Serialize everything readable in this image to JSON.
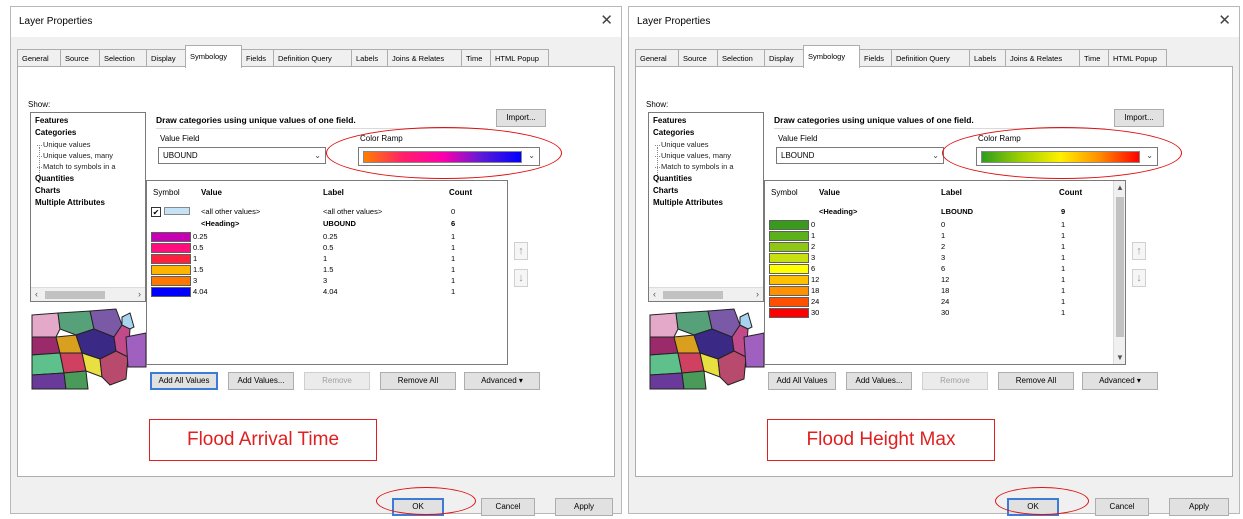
{
  "left": {
    "window_title": "Layer Properties",
    "close_symbol": "✕",
    "tabs": [
      {
        "label": "General"
      },
      {
        "label": "Source"
      },
      {
        "label": "Selection"
      },
      {
        "label": "Display"
      },
      {
        "label": "Symbology"
      },
      {
        "label": "Fields"
      },
      {
        "label": "Definition Query"
      },
      {
        "label": "Labels"
      },
      {
        "label": "Joins & Relates"
      },
      {
        "label": "Time"
      },
      {
        "label": "HTML Popup"
      }
    ],
    "active_tab": "Symbology",
    "show_label": "Show:",
    "show_items": [
      {
        "label": "Features"
      },
      {
        "label": "Categories"
      },
      {
        "label": "Unique values"
      },
      {
        "label": "Unique values, many"
      },
      {
        "label": "Match to symbols in a"
      },
      {
        "label": "Quantities"
      },
      {
        "label": "Charts"
      },
      {
        "label": "Multiple Attributes"
      }
    ],
    "description": "Draw categories using unique values of one field.",
    "import_label": "Import...",
    "value_field_label": "Value Field",
    "value_field_value": "UBOUND",
    "color_ramp_label": "Color Ramp",
    "color_ramp_colors": [
      "#ff7f00",
      "#ff1f6a",
      "#ff00aa",
      "#5d1bd6",
      "#0000ff"
    ],
    "table_headers": {
      "symbol": "Symbol",
      "value": "Value",
      "label": "Label",
      "count": "Count"
    },
    "other_values": {
      "check": "✔",
      "value": "<all other values>",
      "label": "<all other values>",
      "count": "0"
    },
    "heading": {
      "value": "<Heading>",
      "label": "UBOUND",
      "count": "6"
    },
    "rows": [
      {
        "value": "0.25",
        "label": "0.25",
        "count": "1",
        "color": "#c800b4"
      },
      {
        "value": "0.5",
        "label": "0.5",
        "count": "1",
        "color": "#ff0f7d"
      },
      {
        "value": "1",
        "label": "1",
        "count": "1",
        "color": "#ff2040"
      },
      {
        "value": "1.5",
        "label": "1.5",
        "count": "1",
        "color": "#ffb400"
      },
      {
        "value": "3",
        "label": "3",
        "count": "1",
        "color": "#ff7800"
      },
      {
        "value": "4.04",
        "label": "4.04",
        "count": "1",
        "color": "#0000ff"
      }
    ],
    "buttons": {
      "add_all": "Add All Values",
      "add_values": "Add Values...",
      "remove": "Remove",
      "remove_all": "Remove All",
      "advanced": "Advanced"
    },
    "callout": "Flood Arrival Time",
    "ok": "OK",
    "cancel": "Cancel",
    "apply": "Apply"
  },
  "right": {
    "window_title": "Layer Properties",
    "close_symbol": "✕",
    "tabs": [
      {
        "label": "General"
      },
      {
        "label": "Source"
      },
      {
        "label": "Selection"
      },
      {
        "label": "Display"
      },
      {
        "label": "Symbology"
      },
      {
        "label": "Fields"
      },
      {
        "label": "Definition Query"
      },
      {
        "label": "Labels"
      },
      {
        "label": "Joins & Relates"
      },
      {
        "label": "Time"
      },
      {
        "label": "HTML Popup"
      }
    ],
    "active_tab": "Symbology",
    "show_label": "Show:",
    "show_items": [
      {
        "label": "Features"
      },
      {
        "label": "Categories"
      },
      {
        "label": "Unique values"
      },
      {
        "label": "Unique values, many"
      },
      {
        "label": "Match to symbols in a"
      },
      {
        "label": "Quantities"
      },
      {
        "label": "Charts"
      },
      {
        "label": "Multiple Attributes"
      }
    ],
    "description": "Draw categories using unique values of one field.",
    "import_label": "Import...",
    "value_field_label": "Value Field",
    "value_field_value": "LBOUND",
    "color_ramp_label": "Color Ramp",
    "color_ramp_colors": [
      "#2e9c1e",
      "#9fd000",
      "#fff000",
      "#ff8c00",
      "#ff0000"
    ],
    "table_headers": {
      "symbol": "Symbol",
      "value": "Value",
      "label": "Label",
      "count": "Count"
    },
    "heading": {
      "value": "<Heading>",
      "label": "LBOUND",
      "count": "9"
    },
    "rows": [
      {
        "value": "0",
        "label": "0",
        "count": "1",
        "color": "#3a9a1c"
      },
      {
        "value": "1",
        "label": "1",
        "count": "1",
        "color": "#5cb11a"
      },
      {
        "value": "2",
        "label": "2",
        "count": "1",
        "color": "#8ec815"
      },
      {
        "value": "3",
        "label": "3",
        "count": "1",
        "color": "#c7e010"
      },
      {
        "value": "6",
        "label": "6",
        "count": "1",
        "color": "#ffff00"
      },
      {
        "value": "12",
        "label": "12",
        "count": "1",
        "color": "#ffc000"
      },
      {
        "value": "18",
        "label": "18",
        "count": "1",
        "color": "#ff9000"
      },
      {
        "value": "24",
        "label": "24",
        "count": "1",
        "color": "#ff5000"
      },
      {
        "value": "30",
        "label": "30",
        "count": "1",
        "color": "#ff0000"
      }
    ],
    "buttons": {
      "add_all": "Add All Values",
      "add_values": "Add Values...",
      "remove": "Remove",
      "remove_all": "Remove All",
      "advanced": "Advanced"
    },
    "callout": "Flood Height Max",
    "ok": "OK",
    "cancel": "Cancel",
    "apply": "Apply"
  }
}
